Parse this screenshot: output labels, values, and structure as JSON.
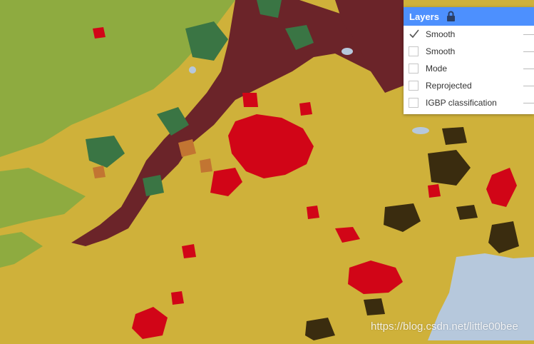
{
  "layers_panel": {
    "title": "Layers",
    "lock_icon": "lock-icon",
    "items": [
      {
        "label": "Smooth",
        "checked": true
      },
      {
        "label": "Smooth",
        "checked": false
      },
      {
        "label": "Mode",
        "checked": false
      },
      {
        "label": "Reprojected",
        "checked": false
      },
      {
        "label": "IGBP classification",
        "checked": false
      }
    ]
  },
  "watermark": "https://blog.csdn.net/little00bee",
  "colors": {
    "cropland": "#cfb13a",
    "grassland": "#8eab40",
    "forest": "#3a7544",
    "savanna": "#6b2429",
    "urban": "#d10517",
    "shrub": "#c27532",
    "barren": "#3a2c0f",
    "water": "#b6c8dc",
    "panel_header": "#4d90fe"
  }
}
